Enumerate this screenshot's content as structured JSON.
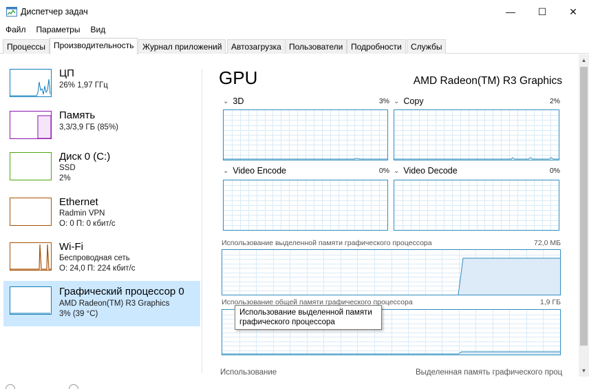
{
  "window": {
    "title": "Диспетчер задач",
    "minimize_icon": "—",
    "maximize_icon": "☐",
    "close_icon": "✕"
  },
  "menu": [
    "Файл",
    "Параметры",
    "Вид"
  ],
  "tabs": [
    "Процессы",
    "Производительность",
    "Журнал приложений",
    "Автозагрузка",
    "Пользователи",
    "Подробности",
    "Службы"
  ],
  "active_tab": "Производительность",
  "sidebar": {
    "items": [
      {
        "title": "ЦП",
        "lines": [
          "26%  1,97 ГГц"
        ],
        "color": "#117dbb"
      },
      {
        "title": "Память",
        "lines": [
          "3,3/3,9 ГБ (85%)"
        ],
        "color": "#8b12ae"
      },
      {
        "title": "Диск 0 (C:)",
        "lines": [
          "SSD",
          "2%"
        ],
        "color": "#4da60c"
      },
      {
        "title": "Ethernet",
        "lines": [
          "Radmin VPN",
          "О: 0 П: 0 кбит/с"
        ],
        "color": "#a74f01"
      },
      {
        "title": "Wi-Fi",
        "lines": [
          "Беспроводная сеть",
          "О: 24,0 П: 224 кбит/с"
        ],
        "color": "#a74f01"
      },
      {
        "title": "Графический процессор 0",
        "lines": [
          "AMD Radeon(TM) R3 Graphics",
          "3% (39 °C)"
        ],
        "color": "#117dbb"
      }
    ]
  },
  "main": {
    "title": "GPU",
    "gpu_name": "AMD Radeon(TM) R3 Graphics",
    "engines": [
      {
        "label": "3D",
        "percent": "3%"
      },
      {
        "label": "Copy",
        "percent": "2%"
      },
      {
        "label": "Video Encode",
        "percent": "0%"
      },
      {
        "label": "Video Decode",
        "percent": "0%"
      }
    ],
    "dedicated_memory": {
      "label": "Использование выделенной памяти графического процессора",
      "value": "72,0 МБ"
    },
    "shared_memory": {
      "label": "Использование общей памяти графического процессора",
      "value": "1,9 ГБ"
    },
    "tooltip": [
      "Использование выделенной памяти",
      "графического процессора"
    ],
    "bottom_left": "Использование",
    "bottom_right": "Выделенная память графического проц"
  },
  "icons": {
    "app": "task-manager-icon",
    "chevron": "chevron-down-icon",
    "scroll_up": "▲",
    "scroll_down": "▼"
  },
  "colors": {
    "gpu_graph": "#2f8dbf",
    "selected_bg": "#cce8ff"
  }
}
